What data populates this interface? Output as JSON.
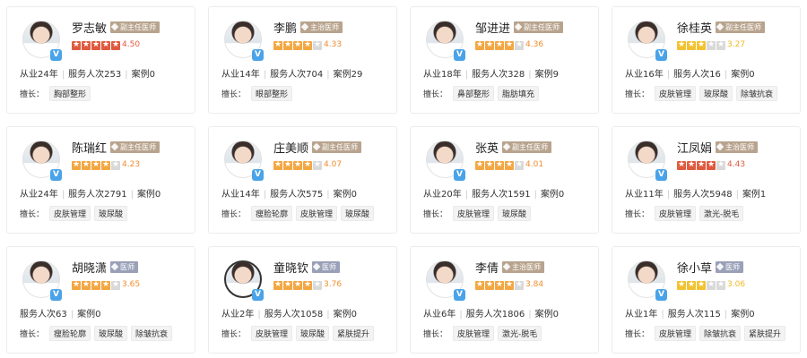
{
  "colors": {
    "star_high": "#e05a3f",
    "star_mid": "#f3a742",
    "star_low": "#f2c230",
    "rating_high": "#e05a3f",
    "rating_mid": "#f08c2d",
    "rating_low": "#f2b824"
  },
  "skill_label": "擅长：",
  "doctors": [
    {
      "name": "罗志敏",
      "title": "副主任医师",
      "rating": "4.50",
      "stars": 5,
      "stats": [
        "从业24年",
        "服务人次253",
        "案例0"
      ],
      "tags": [
        "胸部整形"
      ]
    },
    {
      "name": "李鹏",
      "title": "主治医师",
      "rating": "4.33",
      "stars": 4,
      "stats": [
        "从业14年",
        "服务人次704",
        "案例29"
      ],
      "tags": [
        "眼部整形"
      ]
    },
    {
      "name": "邹进进",
      "title": "副主任医师",
      "rating": "4.36",
      "stars": 4,
      "stats": [
        "从业18年",
        "服务人次328",
        "案例9"
      ],
      "tags": [
        "鼻部整形",
        "脂肪填充"
      ]
    },
    {
      "name": "徐桂英",
      "title": "副主任医师",
      "rating": "3.27",
      "stars": 3,
      "stats": [
        "从业16年",
        "服务人次16",
        "案例0"
      ],
      "tags": [
        "皮肤管理",
        "玻尿酸",
        "除皱抗衰"
      ]
    },
    {
      "name": "陈瑞红",
      "title": "副主任医师",
      "rating": "4.23",
      "stars": 4,
      "stats": [
        "从业24年",
        "服务人次2791",
        "案例0"
      ],
      "tags": [
        "皮肤管理",
        "玻尿酸"
      ]
    },
    {
      "name": "庄美顺",
      "title": "副主任医师",
      "rating": "4.07",
      "stars": 4,
      "stats": [
        "从业14年",
        "服务人次575",
        "案例0"
      ],
      "tags": [
        "瘦脸轮廓",
        "皮肤管理",
        "玻尿酸"
      ]
    },
    {
      "name": "张英",
      "title": "副主任医师",
      "rating": "4.01",
      "stars": 4,
      "stats": [
        "从业20年",
        "服务人次1591",
        "案例0"
      ],
      "tags": [
        "皮肤管理",
        "玻尿酸"
      ]
    },
    {
      "name": "江凤娟",
      "title": "主治医师",
      "rating": "4.43",
      "stars": 4,
      "stats": [
        "从业11年",
        "服务人次5948",
        "案例1"
      ],
      "tags": [
        "皮肤管理",
        "激光-脱毛"
      ]
    },
    {
      "name": "胡晓潇",
      "title": "医师",
      "rating": "3.65",
      "stars": 4,
      "stats": [
        "服务人次63",
        "案例0"
      ],
      "tags": [
        "瘦脸轮廓",
        "玻尿酸",
        "除皱抗衰"
      ]
    },
    {
      "name": "童晓钦",
      "title": "医师",
      "rating": "3.76",
      "stars": 4,
      "stats": [
        "从业2年",
        "服务人次1058",
        "案例0"
      ],
      "tags": [
        "皮肤管理",
        "玻尿酸",
        "紧肤提升"
      ]
    },
    {
      "name": "李倩",
      "title": "主治医师",
      "rating": "3.84",
      "stars": 4,
      "stats": [
        "从业6年",
        "服务人次1806",
        "案例0"
      ],
      "tags": [
        "皮肤管理",
        "激光-脱毛"
      ]
    },
    {
      "name": "徐小草",
      "title": "医师",
      "rating": "3.06",
      "stars": 3,
      "stats": [
        "从业1年",
        "服务人次115",
        "案例0"
      ],
      "tags": [
        "皮肤管理",
        "除皱抗衰",
        "紧肤提升"
      ]
    }
  ]
}
